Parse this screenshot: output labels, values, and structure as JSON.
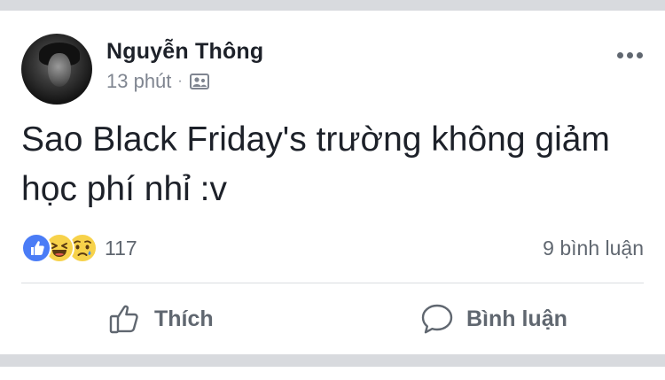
{
  "post": {
    "author": "Nguyễn Thông",
    "time": "13 phút",
    "separator": "·",
    "audience_icon": "friends-icon",
    "text": "Sao Black Friday's trường không giảm học phí nhỉ :v"
  },
  "reactions": {
    "types": [
      "like-icon",
      "haha-icon",
      "sad-icon"
    ],
    "count": "117"
  },
  "comments": {
    "label": "9 bình luận"
  },
  "actions": {
    "like_label": "Thích",
    "comment_label": "Bình luận"
  },
  "colors": {
    "text": "#1d2129",
    "secondary": "#606770",
    "like_blue": "#4a7cf6",
    "emoji_yellow": "#f7d24a",
    "divider": "#dadde1"
  }
}
